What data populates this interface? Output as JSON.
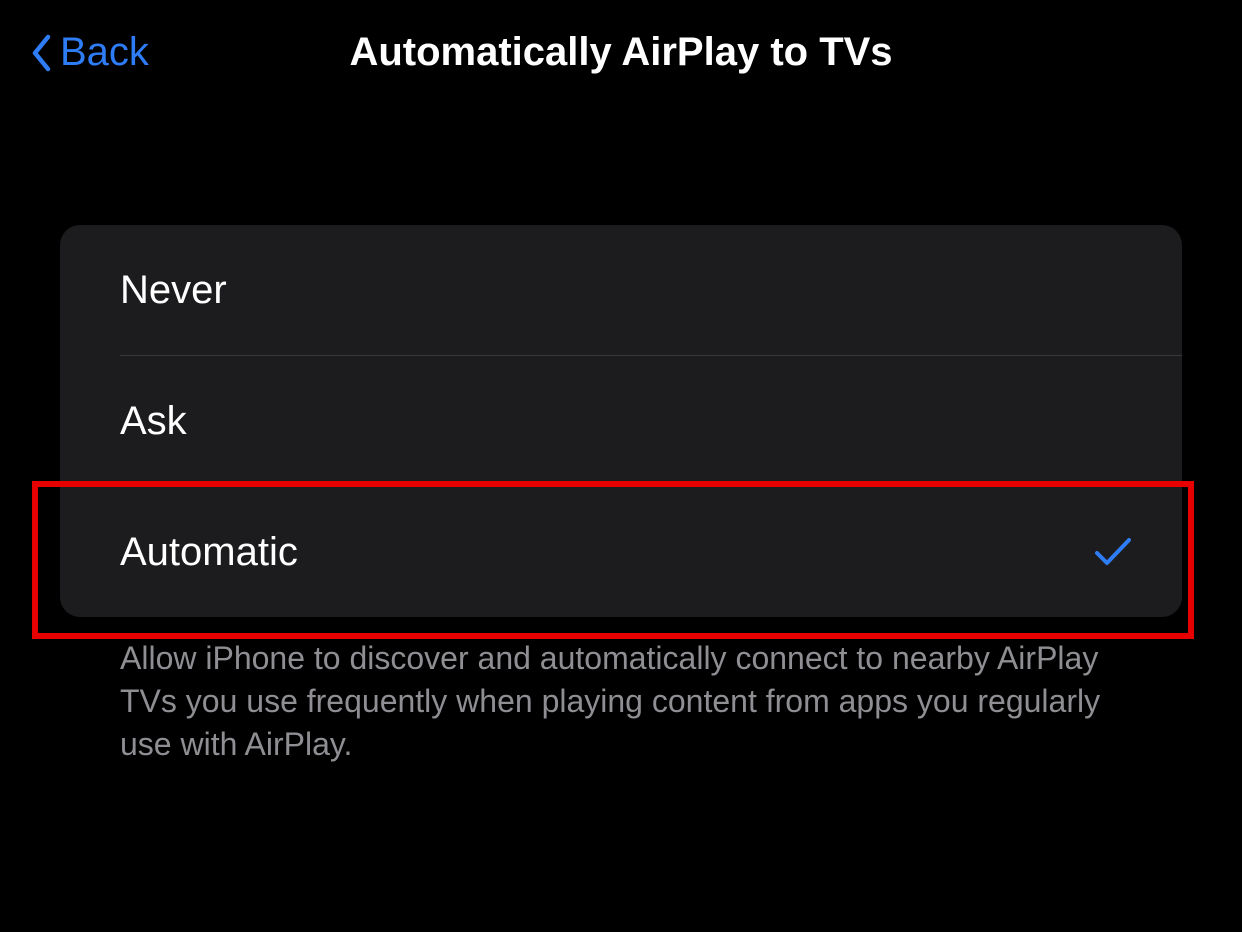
{
  "nav": {
    "back_label": "Back",
    "title": "Automatically AirPlay to TVs"
  },
  "options": [
    {
      "label": "Never",
      "selected": false,
      "highlighted": false,
      "key": "never"
    },
    {
      "label": "Ask",
      "selected": false,
      "highlighted": false,
      "key": "ask"
    },
    {
      "label": "Automatic",
      "selected": true,
      "highlighted": true,
      "key": "automatic"
    }
  ],
  "footer": "Allow iPhone to discover and automatically connect to nearby AirPlay TVs you use frequently when playing content from apps you regularly use with AirPlay.",
  "colors": {
    "accent": "#2e7cf6",
    "highlight": "#e60000",
    "card_bg": "#1c1c1e",
    "secondary_text": "#8e8e93"
  }
}
